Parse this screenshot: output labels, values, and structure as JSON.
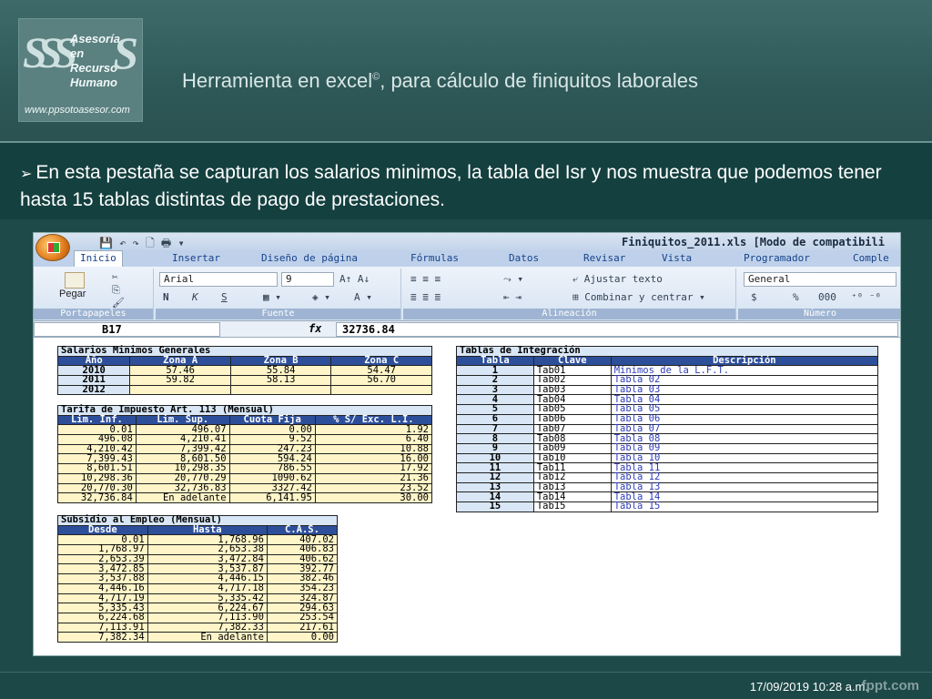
{
  "header": {
    "logo": {
      "line1": "Asesoría",
      "line2": "en",
      "line3": "Recurso",
      "line4": "Humano",
      "url": "www.ppsotoasesor.com"
    },
    "title": "Herramienta en excel",
    "title_mark": "©",
    "title_rest": ", para cálculo de finiquitos laborales"
  },
  "bullet": {
    "text": "En esta pestaña se capturan los salarios minimos, la tabla del Isr y nos muestra que podemos tener hasta 15 tablas distintas de pago de prestaciones."
  },
  "excel": {
    "window_title": "Finiquitos_2011.xls [Modo de compatibili",
    "tabs": [
      "Inicio",
      "Insertar",
      "Diseño de página",
      "Fórmulas",
      "Datos",
      "Revisar",
      "Vista",
      "Programador",
      "Comple"
    ],
    "ribbon": {
      "paste_label": "Pegar",
      "font_name": "Arial",
      "font_size": "9",
      "bold": "N",
      "italic": "K",
      "underline": "S",
      "wrap_text": "Ajustar texto",
      "merge_center": "Combinar y centrar",
      "number_format": "General",
      "currency": "$",
      "percent": "%",
      "thousands": "000",
      "groups": [
        "Portapapeles",
        "Fuente",
        "Alineación",
        "Número"
      ]
    },
    "formula_bar": {
      "name_box": "B17",
      "fx": "fx",
      "value": "32736.84"
    },
    "salarios": {
      "caption": "Salarios Minimos Generales",
      "headers": [
        "Año",
        "Zona A",
        "Zona B",
        "Zona C"
      ],
      "rows": [
        [
          "2010",
          "57.46",
          "55.84",
          "54.47"
        ],
        [
          "2011",
          "59.82",
          "58.13",
          "56.70"
        ],
        [
          "2012",
          "",
          "",
          ""
        ]
      ]
    },
    "tarifa": {
      "caption": "Tarifa de Impuesto Art. 113  (Mensual)",
      "headers": [
        "Lim. Inf.",
        "Lim. Sup.",
        "Cuota Fija",
        "% S/ Exc. L.I."
      ],
      "rows": [
        [
          "0.01",
          "496.07",
          "0.00",
          "1.92"
        ],
        [
          "496.08",
          "4,210.41",
          "9.52",
          "6.40"
        ],
        [
          "4,210.42",
          "7,399.42",
          "247.23",
          "10.88"
        ],
        [
          "7,399.43",
          "8,601.50",
          "594.24",
          "16.00"
        ],
        [
          "8,601.51",
          "10,298.35",
          "786.55",
          "17.92"
        ],
        [
          "10,298.36",
          "20,770.29",
          "1090.62",
          "21.36"
        ],
        [
          "20,770.30",
          "32,736.83",
          "3327.42",
          "23.52"
        ],
        [
          "32,736.84",
          "En adelante",
          "6,141.95",
          "30.00"
        ]
      ]
    },
    "subsidio": {
      "caption": "Subsidio al Empleo  (Mensual)",
      "headers": [
        "Desde",
        "Hasta",
        "C.A.S."
      ],
      "rows": [
        [
          "0.01",
          "1,768.96",
          "407.02"
        ],
        [
          "1,768.97",
          "2,653.38",
          "406.83"
        ],
        [
          "2,653.39",
          "3,472.84",
          "406.62"
        ],
        [
          "3,472.85",
          "3,537.87",
          "392.77"
        ],
        [
          "3,537.88",
          "4,446.15",
          "382.46"
        ],
        [
          "4,446.16",
          "4,717.18",
          "354.23"
        ],
        [
          "4,717.19",
          "5,335.42",
          "324.87"
        ],
        [
          "5,335.43",
          "6,224.67",
          "294.63"
        ],
        [
          "6,224.68",
          "7,113.90",
          "253.54"
        ],
        [
          "7,113.91",
          "7,382.33",
          "217.61"
        ],
        [
          "7,382.34",
          "En adelante",
          "0.00"
        ]
      ]
    },
    "integracion": {
      "caption": "Tablas de Integración",
      "headers": [
        "Tabla",
        "Clave",
        "Descripción"
      ],
      "rows": [
        [
          "1",
          "Tab01",
          "Minimos de la L.F.T."
        ],
        [
          "2",
          "Tab02",
          "Tabla 02"
        ],
        [
          "3",
          "Tab03",
          "Tabla 03"
        ],
        [
          "4",
          "Tab04",
          "Tabla 04"
        ],
        [
          "5",
          "Tab05",
          "Tabla 05"
        ],
        [
          "6",
          "Tab06",
          "Tabla 06"
        ],
        [
          "7",
          "Tab07",
          "Tabla 07"
        ],
        [
          "8",
          "Tab08",
          "Tabla 08"
        ],
        [
          "9",
          "Tab09",
          "Tabla 09"
        ],
        [
          "10",
          "Tab10",
          "Tabla 10"
        ],
        [
          "11",
          "Tab11",
          "Tabla 11"
        ],
        [
          "12",
          "Tab12",
          "Tabla 12"
        ],
        [
          "13",
          "Tab13",
          "Tabla 13"
        ],
        [
          "14",
          "Tab14",
          "Tabla 14"
        ],
        [
          "15",
          "Tab15",
          "Tabla 15"
        ]
      ]
    }
  },
  "footer": {
    "date": "17/09/2019 10:28 a.m.",
    "watermark": "fppt.com"
  }
}
